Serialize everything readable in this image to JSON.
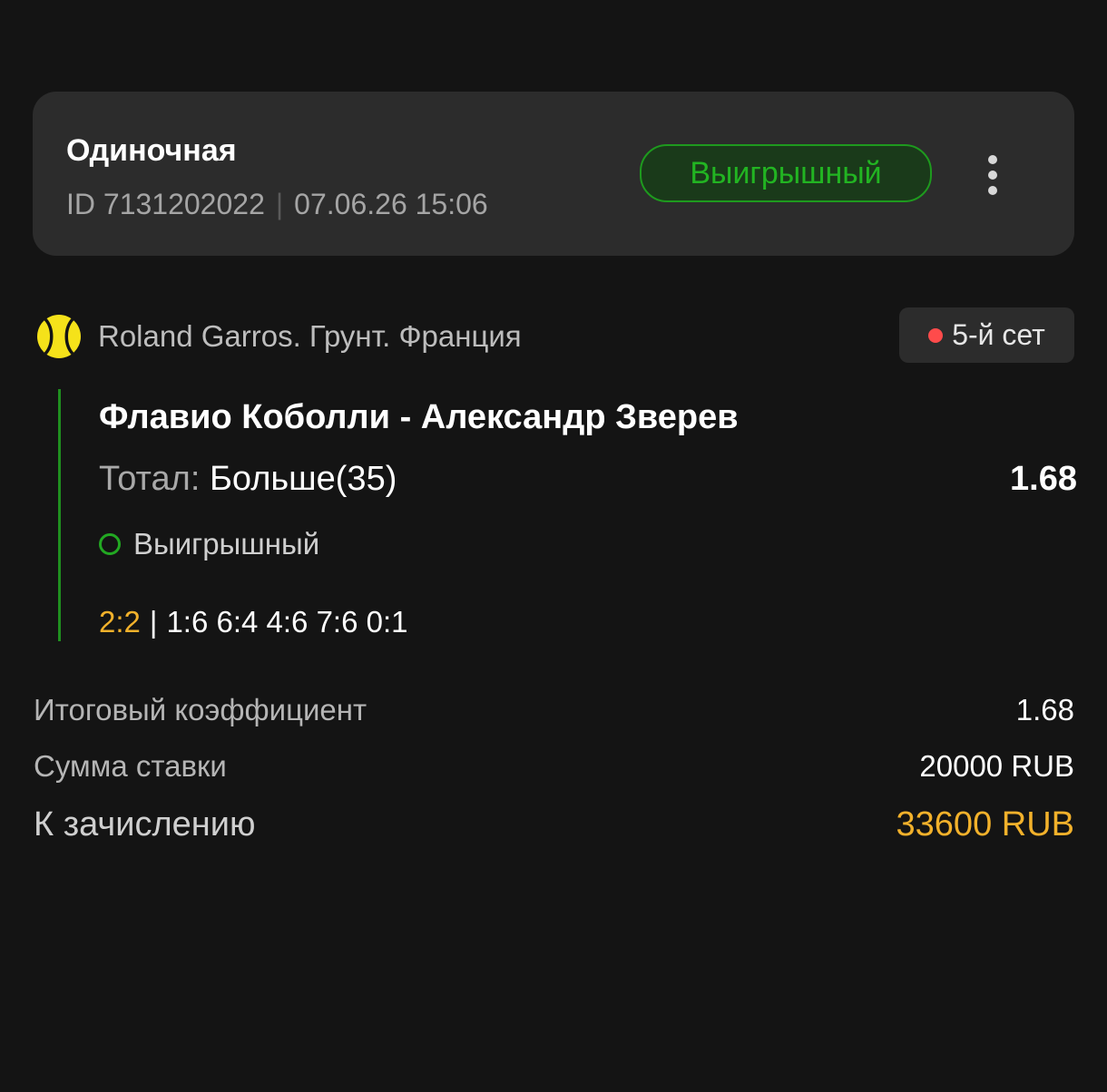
{
  "header": {
    "bet_type": "Одиночная",
    "id_text": "ID 7131202022",
    "datetime": "07.06.26 15:06",
    "status": "Выигрышный",
    "more_icon": "more-vertical-icon"
  },
  "event": {
    "sport_icon": "tennis-ball-icon",
    "tournament": "Roland Garros. Грунт. Франция",
    "live_period": "5-й сет",
    "match": "Флавио Коболли - Александр Зверев",
    "market_label": "Тотал: ",
    "market_value": "Больше(35)",
    "coefficient": "1.68",
    "outcome_status": "Выигрышный",
    "sets_score": "2:2",
    "games_score": "1:6 6:4 4:6 7:6 0:1"
  },
  "summary": {
    "total_coef_label": "Итоговый коэффициент",
    "total_coef_value": "1.68",
    "stake_label": "Сумма ставки",
    "stake_value": "20000 RUB",
    "payout_label": "К зачислению",
    "payout_value": "33600 RUB"
  },
  "colors": {
    "background": "#141414",
    "card": "#2c2c2c",
    "win_green": "#22b422",
    "accent_yellow": "#f2b12b",
    "live_red": "#ff4b4b"
  }
}
